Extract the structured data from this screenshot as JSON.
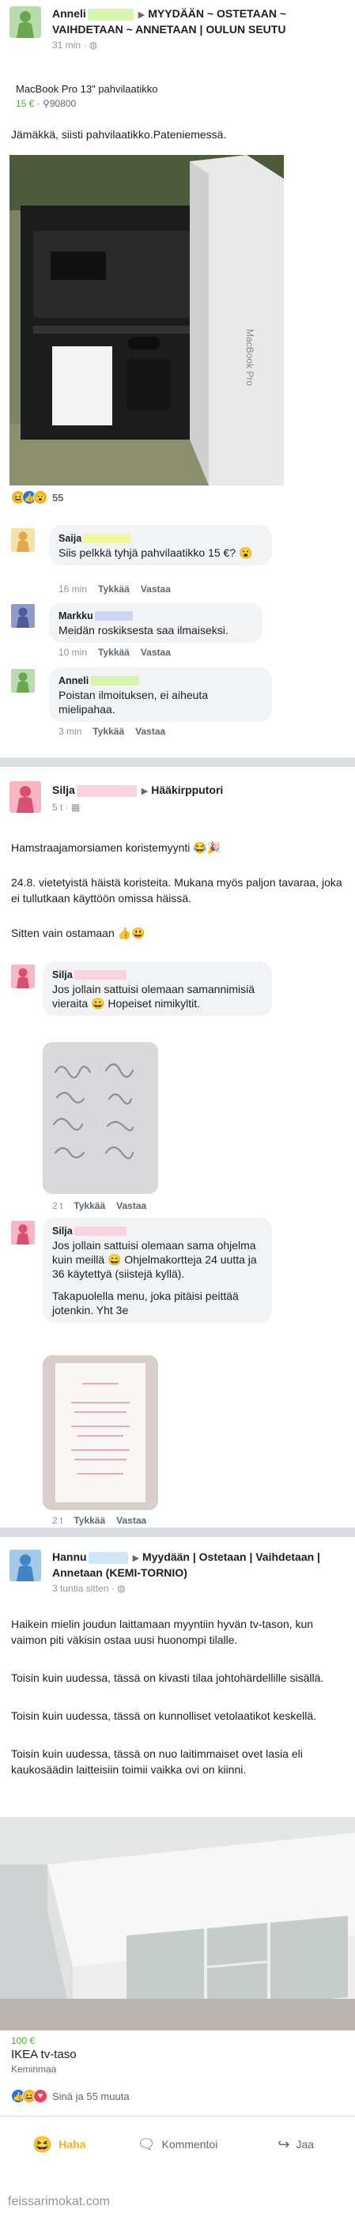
{
  "post1": {
    "author": "Anneli",
    "group": "MYYDÄÄN ~ OSTETAAN ~ VAIHDETAAN ~ ANNETAAN | OULUN SEUTU",
    "time": "31 min",
    "listing_title": "MacBook Pro 13\" pahvilaatikko",
    "price": "15 €",
    "location": "90800",
    "body": "Jämäkkä, siisti pahvilaatikko.Pateniemessä.",
    "reactions_count": "55",
    "comments": [
      {
        "name": "Saija",
        "text": "Siis pelkkä tyhjä pahvilaatikko 15 €? 😮",
        "time": "16 min",
        "like": "Tykkää",
        "reply": "Vastaa"
      },
      {
        "name": "Markku",
        "text": "Meidän roskiksesta saa ilmaiseksi.",
        "time": "10 min",
        "like": "Tykkää",
        "reply": "Vastaa"
      },
      {
        "name": "Anneli",
        "text": "Poistan ilmoituksen, ei aiheuta mielipahaa.",
        "time": "3 min",
        "like": "Tykkää",
        "reply": "Vastaa"
      }
    ]
  },
  "post2": {
    "author": "Silja",
    "group": "Hääkirpputori",
    "time": "5 t",
    "body_lines": [
      "Hamstraajamorsiamen koristemyynti 😂🎉",
      "24.8. vietetyistä häistä koristeita. Mukana myös paljon tavaraa, joka ei tullutkaan käyttöön omissa häissä.",
      "Sitten vain ostamaan 👍😃"
    ],
    "comments": [
      {
        "name": "Silja",
        "text": "Jos jollain sattuisi olemaan samannimisiä vieraita 😀 Hopeiset nimikyltit.",
        "time": "2 t",
        "like": "Tykkää",
        "reply": "Vastaa"
      },
      {
        "name": "Silja",
        "text": "Jos jollain sattuisi olemaan sama ohjelma kuin meillä 😄 Ohjelmakortteja 24 uutta ja 36 käytettyä (siistejä kyllä).",
        "text2": "Takapuolella menu, joka pitäisi peittää jotenkin. Yht 3e",
        "time": "2 t",
        "like": "Tykkää",
        "reply": "Vastaa"
      }
    ]
  },
  "post3": {
    "author": "Hannu",
    "group": "Myydään | Ostetaan | Vaihdetaan | Annetaan (KEMI-TORNIO)",
    "time": "3 tuntia sitten",
    "body_lines": [
      "Haikein mielin joudun laittamaan myyntiin hyvän tv-tason, kun vaimon piti väkisin ostaa uusi huonompi tilalle.",
      "Toisin kuin uudessa, tässä on kivasti tilaa johtohärdellille sisällä.",
      "Toisin kuin uudessa, tässä on kunnolliset vetolaatikot keskellä.",
      "Toisin kuin uudessa, tässä on nuo laitimmaiset ovet lasia eli kaukosäädin laitteisiin toimii vaikka ovi on kiinni."
    ],
    "price": "100 €",
    "listing_title": "IKEA tv-taso",
    "location": "Keminmaa",
    "reactions_text": "Sinä ja 55 muuta",
    "actions": {
      "like": "Haha",
      "comment": "Kommentoi",
      "share": "Jaa"
    }
  },
  "watermark": "feissarimokat.com",
  "colors": {
    "female_avatar_bg": "#f7b7c4",
    "male_avatar_bg": "#a4c9e4",
    "green_avatar_bg": "#b9dcae",
    "accent_green": "#42b72a"
  }
}
